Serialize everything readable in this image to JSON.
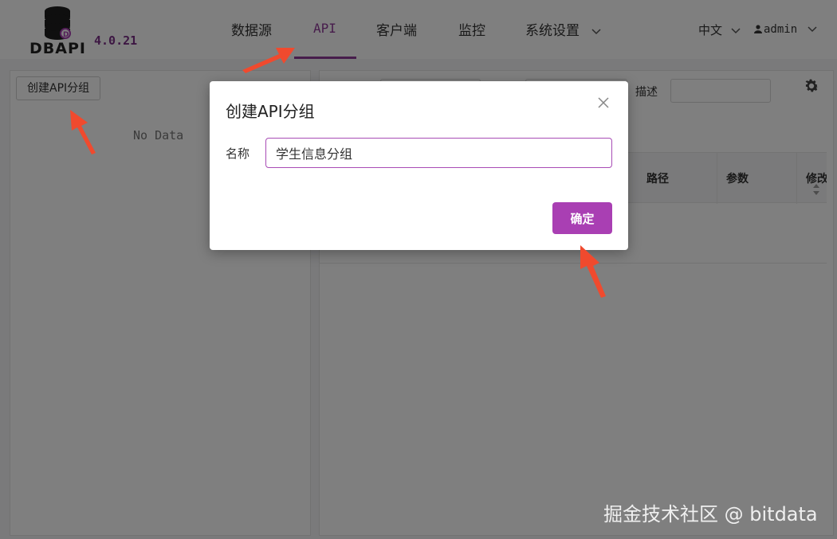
{
  "app": {
    "logo_text": "DBAPI",
    "version": "4.0.21"
  },
  "nav": {
    "items": [
      {
        "label": "数据源"
      },
      {
        "label": "API"
      },
      {
        "label": "客户端"
      },
      {
        "label": "监控"
      },
      {
        "label": "系统设置"
      }
    ],
    "active": "API",
    "language": "中文",
    "user": "admin"
  },
  "left_panel": {
    "create_group_label": "创建API分组",
    "empty_text": "No Data"
  },
  "right_panel": {
    "filter_desc_label": "描述",
    "table_headers": [
      "路径",
      "参数",
      "修改"
    ]
  },
  "modal": {
    "title": "创建API分组",
    "name_label": "名称",
    "name_value": "学生信息分组",
    "confirm_label": "确定"
  },
  "watermark": "掘金技术社区 @ bitdata",
  "colors": {
    "accent": "#a93fb3",
    "annotation_arrow": "#f04a2e"
  }
}
